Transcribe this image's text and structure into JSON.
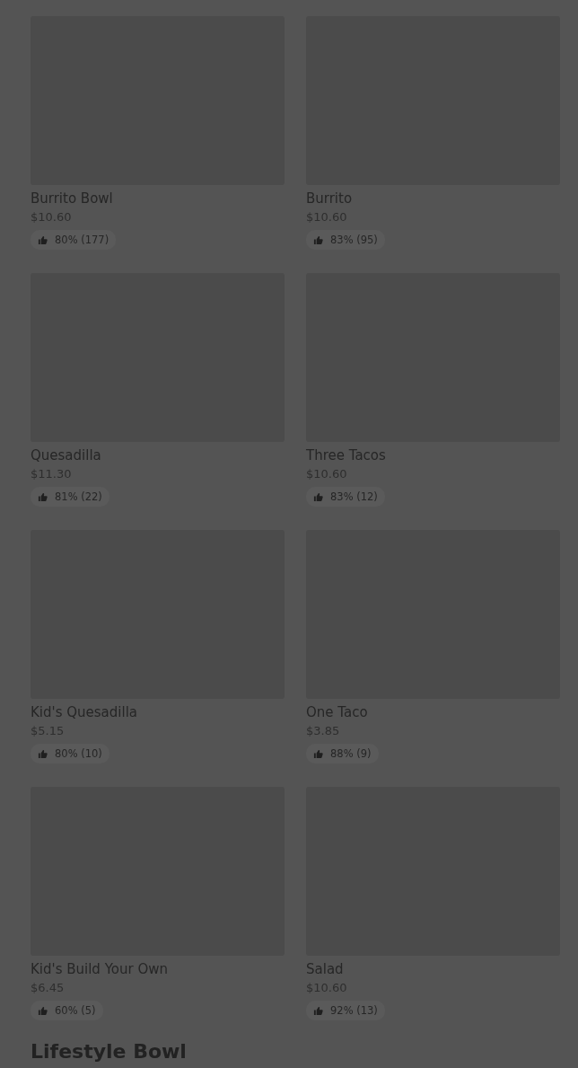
{
  "menu_items": [
    {
      "name": "Burrito Bowl",
      "price": "$10.60",
      "rating": "80% (177)"
    },
    {
      "name": "Burrito",
      "price": "$10.60",
      "rating": "83% (95)"
    },
    {
      "name": "Quesadilla",
      "price": "$11.30",
      "rating": "81% (22)"
    },
    {
      "name": "Three Tacos",
      "price": "$10.60",
      "rating": "83% (12)"
    },
    {
      "name": "Kid's Quesadilla",
      "price": "$5.15",
      "rating": "80% (10)"
    },
    {
      "name": "One Taco",
      "price": "$3.85",
      "rating": "88% (9)"
    },
    {
      "name": "Kid's Build Your Own",
      "price": "$6.45",
      "rating": "60% (5)"
    },
    {
      "name": "Salad",
      "price": "$10.60",
      "rating": "92% (13)"
    }
  ],
  "next_section": {
    "title": "Lifestyle Bowl"
  }
}
